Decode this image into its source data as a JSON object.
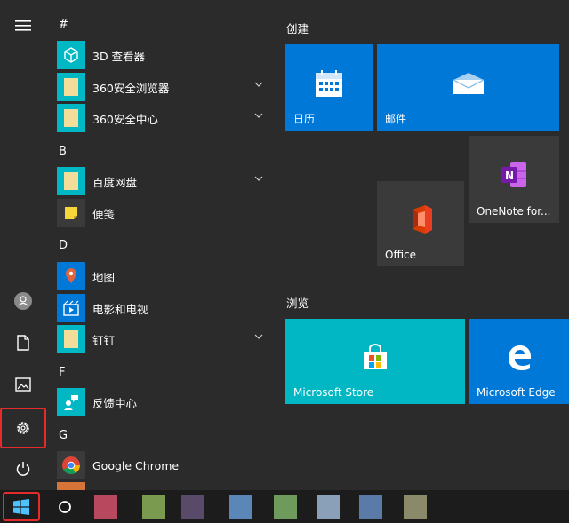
{
  "applist": {
    "groups": [
      "#",
      "B",
      "D",
      "F",
      "G"
    ],
    "apps": [
      {
        "label": "3D 查看器",
        "icon": "3d-viewer-icon",
        "expandable": false
      },
      {
        "label": "360安全浏览器",
        "icon": "folder-icon",
        "expandable": true
      },
      {
        "label": "360安全中心",
        "icon": "folder-icon",
        "expandable": true
      },
      {
        "label": "百度网盘",
        "icon": "folder-icon",
        "expandable": true
      },
      {
        "label": "便笺",
        "icon": "sticky-notes-icon",
        "expandable": false
      },
      {
        "label": "地图",
        "icon": "maps-icon",
        "expandable": false
      },
      {
        "label": "电影和电视",
        "icon": "movies-tv-icon",
        "expandable": false
      },
      {
        "label": "钉钉",
        "icon": "folder-icon",
        "expandable": true
      },
      {
        "label": "反馈中心",
        "icon": "feedback-hub-icon",
        "expandable": false
      },
      {
        "label": "Google Chrome",
        "icon": "chrome-icon",
        "expandable": false
      }
    ]
  },
  "tiles": {
    "section_create": "创建",
    "section_browse": "浏览",
    "calendar": "日历",
    "mail": "邮件",
    "onenote": "OneNote for...",
    "office": "Office",
    "store": "Microsoft Store",
    "edge": "Microsoft Edge"
  },
  "colors": {
    "background": "#2b2b2b",
    "tile_blue": "#0078d7",
    "tile_teal": "#00b7c3",
    "tile_dark": "#3a3a3a",
    "highlight_red": "#e52b2b",
    "taskbar": "#1c1c1c"
  }
}
